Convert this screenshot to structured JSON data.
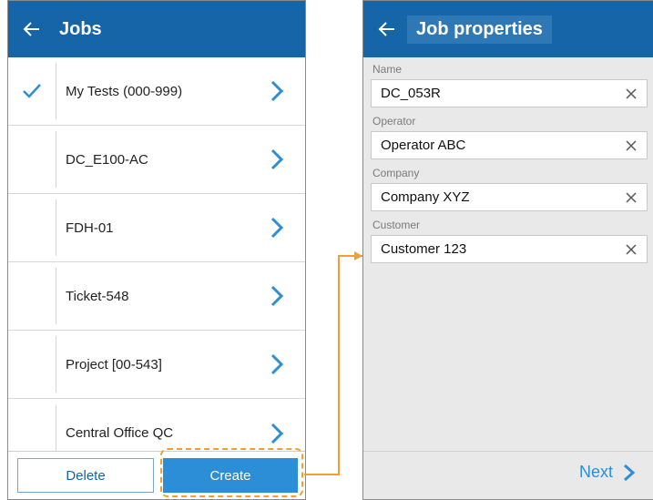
{
  "jobs_screen": {
    "title": "Jobs",
    "items": [
      {
        "label": "My Tests (000-999)",
        "selected": true
      },
      {
        "label": "DC_E100-AC",
        "selected": false
      },
      {
        "label": "FDH-01",
        "selected": false
      },
      {
        "label": "Ticket-548",
        "selected": false
      },
      {
        "label": "Project [00-543]",
        "selected": false
      },
      {
        "label": "Central Office QC",
        "selected": false
      }
    ],
    "delete_label": "Delete",
    "create_label": "Create"
  },
  "properties_screen": {
    "title": "Job properties",
    "fields": [
      {
        "label": "Name",
        "value": "DC_053R"
      },
      {
        "label": "Operator",
        "value": "Operator ABC"
      },
      {
        "label": "Company",
        "value": "Company XYZ"
      },
      {
        "label": "Customer",
        "value": "Customer 123"
      }
    ],
    "next_label": "Next"
  },
  "colors": {
    "appbar": "#1565a8",
    "accent": "#2c8ed6",
    "highlight": "#f0a030"
  },
  "icons": [
    "back-arrow-icon",
    "checkmark-icon",
    "chevron-right-icon",
    "clear-x-icon"
  ]
}
